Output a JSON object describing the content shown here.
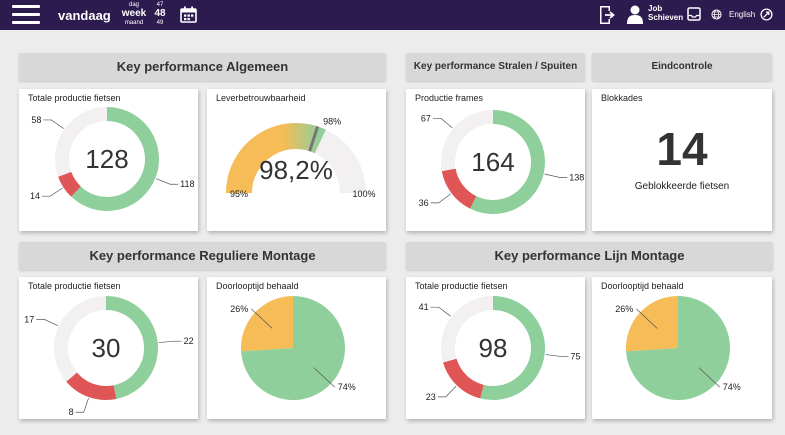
{
  "topbar": {
    "brand": "vandaag",
    "period": {
      "top": "dag",
      "middle": "week",
      "bottom": "maand"
    },
    "week_numbers": [
      "47",
      "48",
      "49"
    ],
    "user": {
      "line1": "Job",
      "line2": "Schieven"
    },
    "language": "English"
  },
  "sections": {
    "algemeen": "Key performance Algemeen",
    "stralen": "Key performance Stralen / Spuiten",
    "eindcontrole": "Eindcontrole",
    "reguliere": "Key performance Reguliere Montage",
    "lijn": "Key performance Lijn Montage"
  },
  "cards": {
    "algemeen_productie": {
      "title": "Totale productie fietsen",
      "center": "128",
      "segments": [
        {
          "label": "118",
          "value": 118,
          "color": "#8fcf9c"
        },
        {
          "label": "14",
          "value": 14,
          "color": "#e05555"
        },
        {
          "label": "58",
          "value": 58,
          "color": "#f2f0f0"
        }
      ]
    },
    "leverbetrouwbaarheid": {
      "title": "Leverbetrouwbaarheid",
      "value_label": "98,2%",
      "value": 98.2,
      "target_label": "98%",
      "min_label": "95%",
      "max_label": "100%",
      "min": 95,
      "max": 100,
      "target": 98
    },
    "stralen_productie": {
      "title": "Productie frames",
      "center": "164",
      "segments": [
        {
          "label": "138",
          "value": 138,
          "color": "#8fcf9c"
        },
        {
          "label": "36",
          "value": 36,
          "color": "#e05555"
        },
        {
          "label": "67",
          "value": 67,
          "color": "#f2f0f0"
        }
      ]
    },
    "blokkades": {
      "title": "Blokkades",
      "value": "14",
      "caption": "Geblokkeerde fietsen"
    },
    "reguliere_productie": {
      "title": "Totale productie fietsen",
      "center": "30",
      "segments": [
        {
          "label": "22",
          "value": 22,
          "color": "#8fcf9c"
        },
        {
          "label": "8",
          "value": 8,
          "color": "#e05555"
        },
        {
          "label": "17",
          "value": 17,
          "color": "#f2f0f0"
        }
      ]
    },
    "reguliere_doorloop": {
      "title": "Doorlooptijd behaald",
      "slices": [
        {
          "label": "74%",
          "value": 74,
          "color": "#8fcf9c"
        },
        {
          "label": "26%",
          "value": 26,
          "color": "#f5bc57"
        }
      ]
    },
    "lijn_productie": {
      "title": "Totale productie fietsen",
      "center": "98",
      "segments": [
        {
          "label": "75",
          "value": 75,
          "color": "#8fcf9c"
        },
        {
          "label": "23",
          "value": 23,
          "color": "#e05555"
        },
        {
          "label": "41",
          "value": 41,
          "color": "#f2f0f0"
        }
      ]
    },
    "lijn_doorloop": {
      "title": "Doorlooptijd behaald",
      "slices": [
        {
          "label": "74%",
          "value": 74,
          "color": "#8fcf9c"
        },
        {
          "label": "26%",
          "value": 26,
          "color": "#f5bc57"
        }
      ]
    }
  }
}
